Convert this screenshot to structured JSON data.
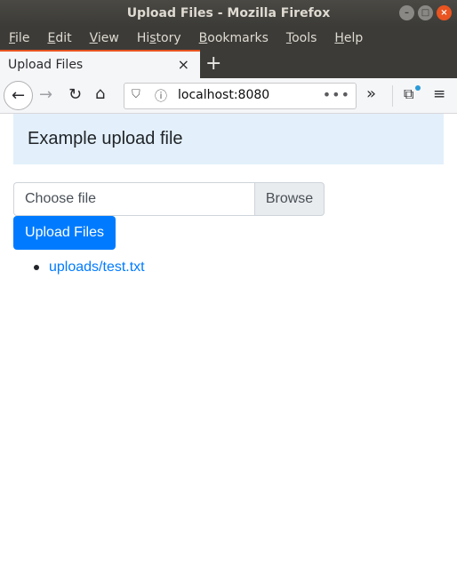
{
  "window": {
    "title": "Upload Files - Mozilla Firefox",
    "minimize": "–",
    "maximize": "□",
    "close": "×"
  },
  "menu": {
    "items": [
      {
        "label_ul": "F",
        "label_rest": "ile"
      },
      {
        "label_ul": "E",
        "label_rest": "dit"
      },
      {
        "label_ul": "V",
        "label_rest": "iew"
      },
      {
        "label_pre": "Hi",
        "label_ul": "s",
        "label_rest": "tory"
      },
      {
        "label_ul": "B",
        "label_rest": "ookmarks"
      },
      {
        "label_ul": "T",
        "label_rest": "ools"
      },
      {
        "label_ul": "H",
        "label_rest": "elp"
      }
    ]
  },
  "tabs": [
    {
      "title": "Upload Files",
      "close": "×"
    }
  ],
  "newtab": "+",
  "nav": {
    "back": "←",
    "forward": "→",
    "reload": "↻",
    "home": "⌂",
    "shield": "⛉",
    "info": "ⓘ",
    "url": "localhost:8080",
    "page_actions": "•••",
    "overflow": "»",
    "extensions": "⧉",
    "menu": "≡"
  },
  "page": {
    "heading": "Example upload file",
    "file_input_label": "Choose file",
    "browse_label": "Browse",
    "upload_button": "Upload Files",
    "files": [
      {
        "name": "uploads/test.txt"
      }
    ]
  },
  "colors": {
    "accent": "#e95420",
    "primary": "#007bff",
    "jumbotron": "#e3f0fb"
  }
}
